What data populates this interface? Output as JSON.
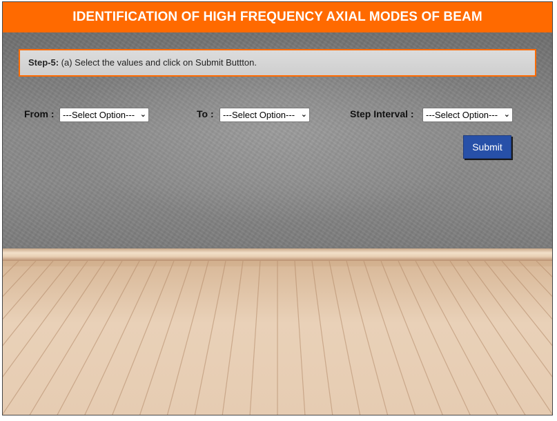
{
  "header": {
    "title": "IDENTIFICATION OF HIGH FREQUENCY AXIAL MODES OF BEAM"
  },
  "instruction": {
    "step_label": "Step-5:",
    "text": " (a) Select the values and click on Submit Buttton."
  },
  "form": {
    "from": {
      "label": "From :",
      "selected": "---Select Option---"
    },
    "to": {
      "label": "To :",
      "selected": "---Select Option---"
    },
    "step_interval": {
      "label": "Step Interval :",
      "selected": "---Select Option---"
    },
    "submit_label": "Submit"
  },
  "icons": {
    "dropdown": "chevron-down-icon"
  },
  "colors": {
    "header_bg": "#ff6a00",
    "step_border": "#ff6a00",
    "submit_bg": "#2750a8"
  }
}
